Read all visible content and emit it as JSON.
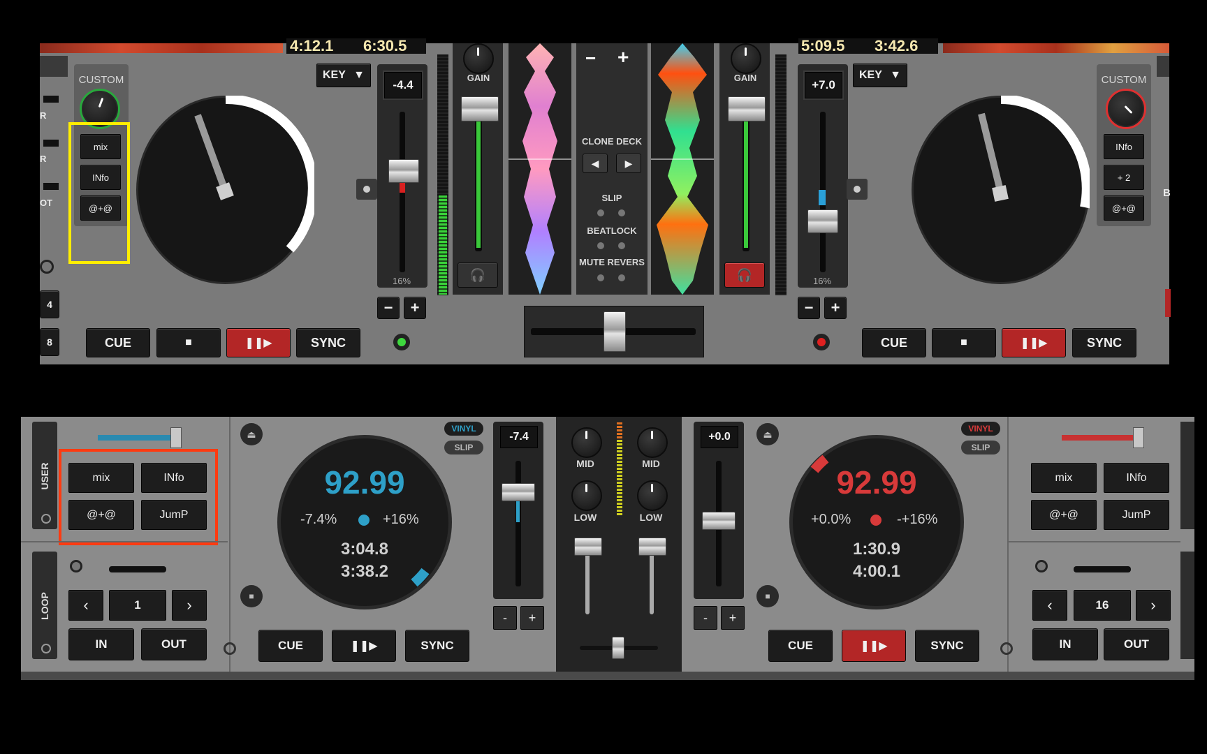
{
  "top": {
    "left_deck": {
      "time_elapsed": "4:12.1",
      "time_remaining": "6:30.5",
      "key_label": "KEY",
      "custom_label": "CUSTOM",
      "custom_buttons": [
        "mix",
        "INfo",
        "@+@"
      ],
      "pitch_value": "-4.4",
      "pitch_range": "16%",
      "gain_label": "GAIN",
      "transport": {
        "cue": "CUE",
        "sync": "SYNC"
      },
      "edge_labels": [
        "R",
        "R",
        "OT",
        "4",
        "8"
      ],
      "highlight_color": "#ffee00"
    },
    "right_deck": {
      "time_elapsed": "5:09.5",
      "time_remaining": "3:42.6",
      "key_label": "KEY",
      "custom_label": "CUSTOM",
      "custom_buttons": [
        "INfo",
        "+ 2",
        "@+@"
      ],
      "pitch_value": "+7.0",
      "pitch_range": "16%",
      "gain_label": "GAIN",
      "transport": {
        "cue": "CUE",
        "sync": "SYNC"
      },
      "edge_labels": [
        "B"
      ]
    },
    "center": {
      "zoom_minus": "−",
      "zoom_plus": "+",
      "clone_deck": "CLONE DECK",
      "slip": "SLIP",
      "beatlock": "BEATLOCK",
      "mute_reverse": "MUTE REVERS"
    }
  },
  "bottom": {
    "left_deck": {
      "user_tab": "USER",
      "loop_tab": "LOOP",
      "user_buttons": [
        "mix",
        "INfo",
        "@+@",
        "JumP"
      ],
      "vinyl": "VINYL",
      "slip": "SLIP",
      "bpm": "92.99",
      "pitch_offset": "-7.4%",
      "pitch_range": "+16%",
      "time_elapsed": "3:04.8",
      "time_remaining": "3:38.2",
      "pitch_value": "-7.4",
      "loop_value": "1",
      "loop_in": "IN",
      "loop_out": "OUT",
      "transport": {
        "cue": "CUE",
        "sync": "SYNC"
      },
      "fader_minus": "-",
      "fader_plus": "+",
      "accent": "#2ea0c8",
      "highlight_color": "#ff3a10"
    },
    "right_deck": {
      "user_buttons": [
        "mix",
        "INfo",
        "@+@",
        "JumP"
      ],
      "vinyl": "VINYL",
      "slip": "SLIP",
      "bpm": "92.99",
      "pitch_offset": "+0.0%",
      "pitch_range": "-+16%",
      "time_elapsed": "1:30.9",
      "time_remaining": "4:00.1",
      "pitch_value": "+0.0",
      "loop_value": "16",
      "loop_in": "IN",
      "loop_out": "OUT",
      "transport": {
        "cue": "CUE",
        "sync": "SYNC"
      },
      "fader_minus": "-",
      "fader_plus": "+",
      "accent": "#d83a3a"
    },
    "mixer": {
      "mid": "MID",
      "low": "LOW"
    }
  }
}
